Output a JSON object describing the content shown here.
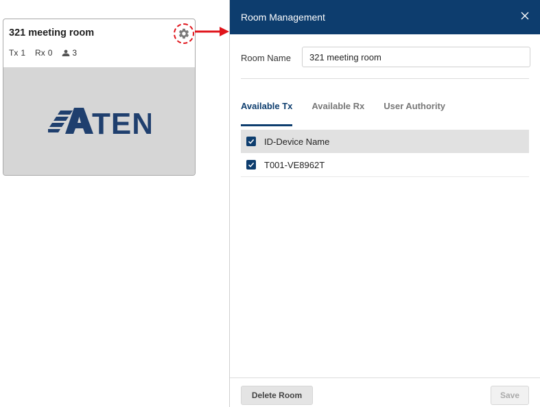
{
  "card": {
    "title": "321 meeting room",
    "tx_label": "Tx",
    "tx_count": "1",
    "rx_label": "Rx",
    "rx_count": "0",
    "users_count": "3",
    "logo_text": "ATEN",
    "settings_icon": "gear-icon"
  },
  "dialog": {
    "title": "Room Management",
    "close_icon": "close-icon",
    "room_name_label": "Room Name",
    "room_name_value": "321 meeting room",
    "tabs": [
      {
        "label": "Available Tx",
        "active": true
      },
      {
        "label": "Available Rx",
        "active": false
      },
      {
        "label": "User Authority",
        "active": false
      }
    ],
    "list_header": "ID-Device Name",
    "devices": [
      {
        "name": "T001-VE8962T",
        "checked": true
      }
    ],
    "delete_button": "Delete Room",
    "save_button": "Save"
  },
  "colors": {
    "header_bg": "#0d3d6e",
    "accent": "#0d3d6e",
    "highlight_red": "#e0141b",
    "logo_blue": "#1f3f6e"
  }
}
